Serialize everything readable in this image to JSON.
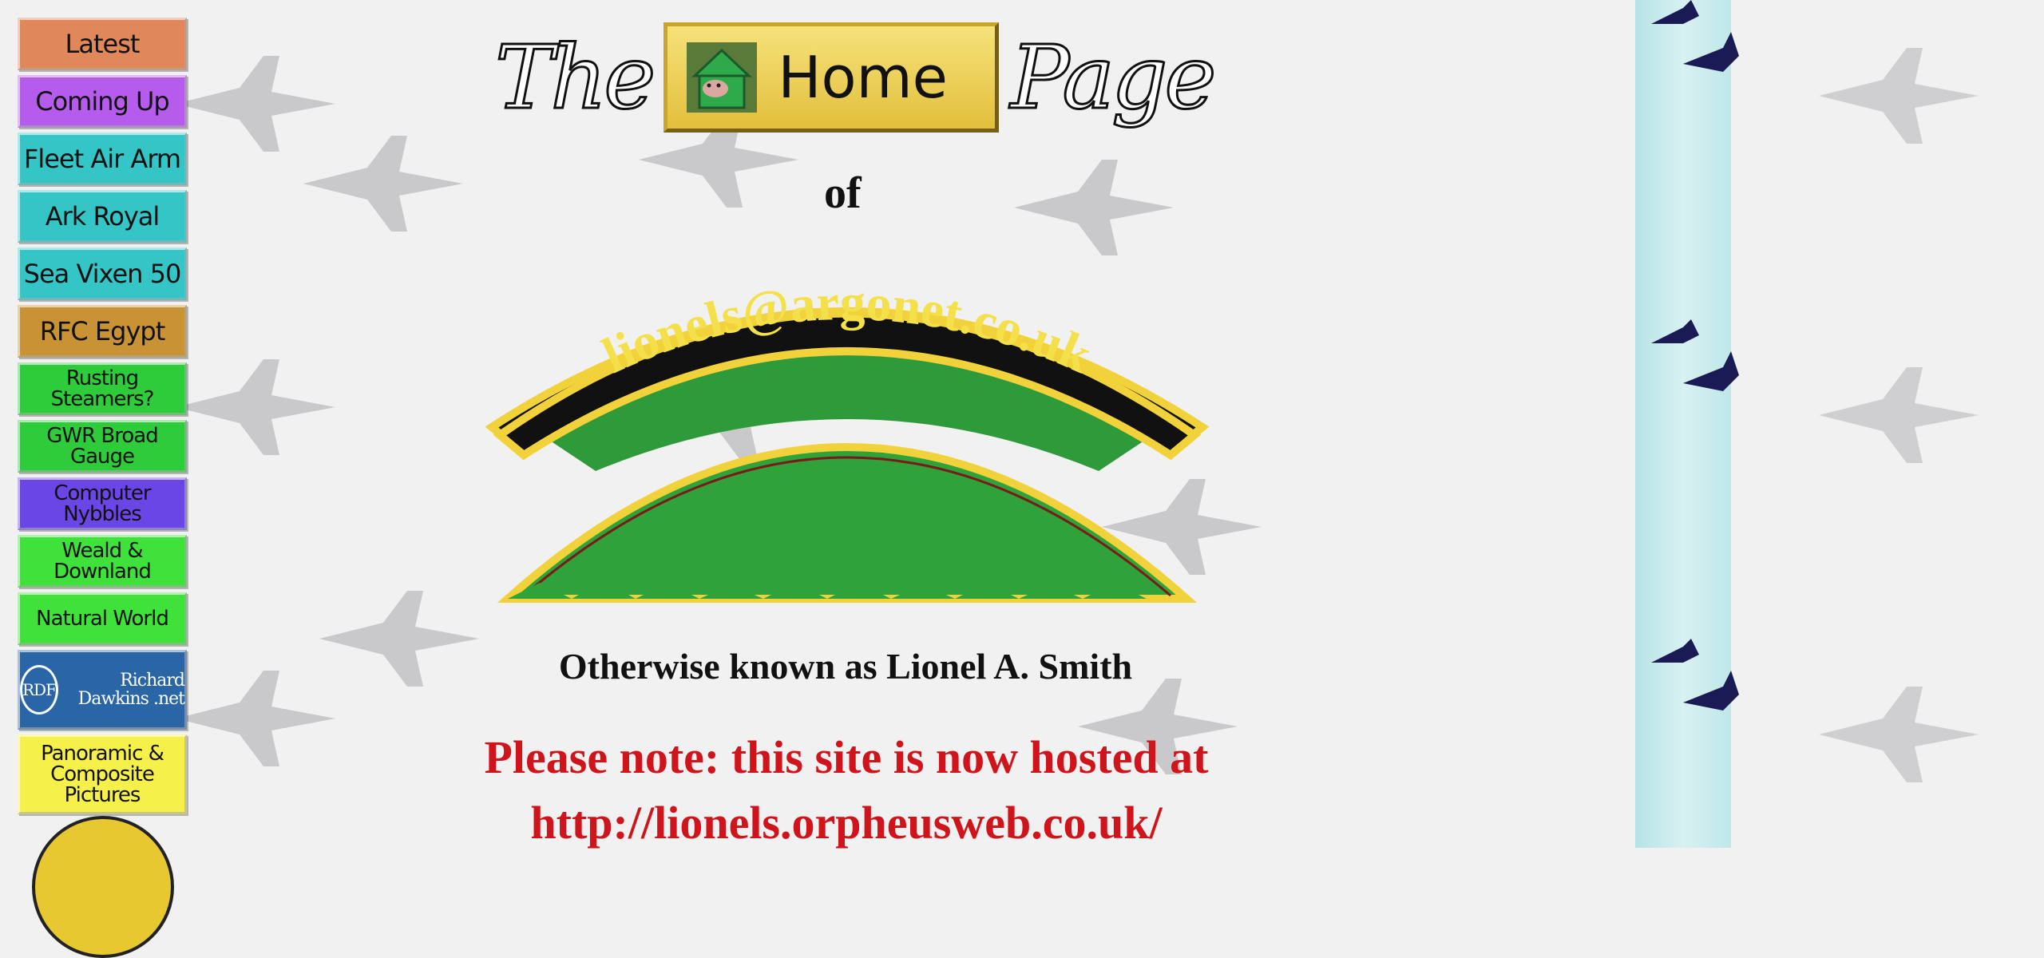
{
  "nav": {
    "latest": "Latest",
    "coming_up": "Coming Up",
    "fleet_air_arm": "Fleet Air Arm",
    "ark_royal": "Ark Royal",
    "sea_vixen": "Sea Vixen 50",
    "rfc_egypt": "RFC Egypt",
    "rusting_steamers": "Rusting Steamers?",
    "gwr": "GWR Broad Gauge",
    "computer": "Computer Nybbles",
    "weald": "Weald & Downland",
    "natural": "Natural World",
    "rdf_logo": "RDF",
    "rdf_text": "Richard Dawkins .net",
    "panoramic": "Panoramic & Composite Pictures"
  },
  "title": {
    "the": "The",
    "home": "Home",
    "page": "Page"
  },
  "of": "of",
  "logo_text": "lionels@argonet.co.uk",
  "aka": "Otherwise known as Lionel A. Smith",
  "note": "Please note: this site is now hosted at http://lionels.orpheusweb.co.uk/",
  "colors": {
    "latest": "#e0885a",
    "coming_up": "#b65cec",
    "cyan": "#34c6c6",
    "rfc": "#c99234",
    "green": "#2ecc3a",
    "purple": "#6a46e6",
    "bright_green": "#3ee23a",
    "rdf": "#2a66a6",
    "yellow": "#f6f04a",
    "note_red": "#d0141c"
  }
}
